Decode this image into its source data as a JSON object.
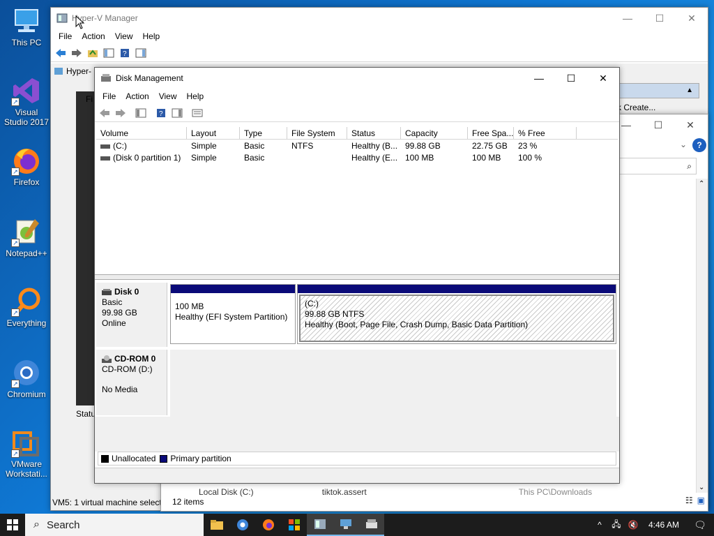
{
  "desktop": {
    "icons": [
      {
        "label": "This PC"
      },
      {
        "label": "Visual Studio 2017"
      },
      {
        "label": "Firefox"
      },
      {
        "label": "Notepad++"
      },
      {
        "label": "Everything"
      },
      {
        "label": "Chromium"
      },
      {
        "label": "VMware Workstati..."
      }
    ]
  },
  "hyperv": {
    "title": "Hyper-V Manager",
    "menu": [
      "File",
      "Action",
      "View",
      "Help"
    ],
    "tree_item": "Hyper-",
    "sub_menu_file": "Fi",
    "action_create": "k Create...",
    "status": "VM5:  1 virtual machine select",
    "status_left": "Statu"
  },
  "explorer": {
    "items_count": "12 items",
    "bottom_items": [
      "Local Disk (C:)",
      "tiktok.assert",
      "This PC\\Downloads"
    ]
  },
  "diskmgmt": {
    "title": "Disk Management",
    "menu": [
      "File",
      "Action",
      "View",
      "Help"
    ],
    "columns": [
      "Volume",
      "Layout",
      "Type",
      "File System",
      "Status",
      "Capacity",
      "Free Spa...",
      "% Free"
    ],
    "volumes": [
      {
        "volume": "(C:)",
        "layout": "Simple",
        "type": "Basic",
        "fs": "NTFS",
        "status": "Healthy (B...",
        "capacity": "99.88 GB",
        "free": "22.75 GB",
        "pct": "23 %"
      },
      {
        "volume": "(Disk 0 partition 1)",
        "layout": "Simple",
        "type": "Basic",
        "fs": "",
        "status": "Healthy (E...",
        "capacity": "100 MB",
        "free": "100 MB",
        "pct": "100 %"
      }
    ],
    "disk0": {
      "name": "Disk 0",
      "kind": "Basic",
      "size": "99.98 GB",
      "state": "Online"
    },
    "part_efi": {
      "size": "100 MB",
      "status": "Healthy (EFI System Partition)"
    },
    "part_c": {
      "name": "(C:)",
      "size": "99.88 GB NTFS",
      "status": "Healthy (Boot, Page File, Crash Dump, Basic Data Partition)"
    },
    "cdrom": {
      "name": "CD-ROM 0",
      "drive": "CD-ROM (D:)",
      "media": "No Media"
    },
    "legend": {
      "unallocated": "Unallocated",
      "primary": "Primary partition"
    }
  },
  "taskbar": {
    "search_placeholder": "Search",
    "time": "4:46 AM"
  },
  "colors": {
    "primary_partition": "#0a0a78",
    "unallocated": "#000000"
  }
}
